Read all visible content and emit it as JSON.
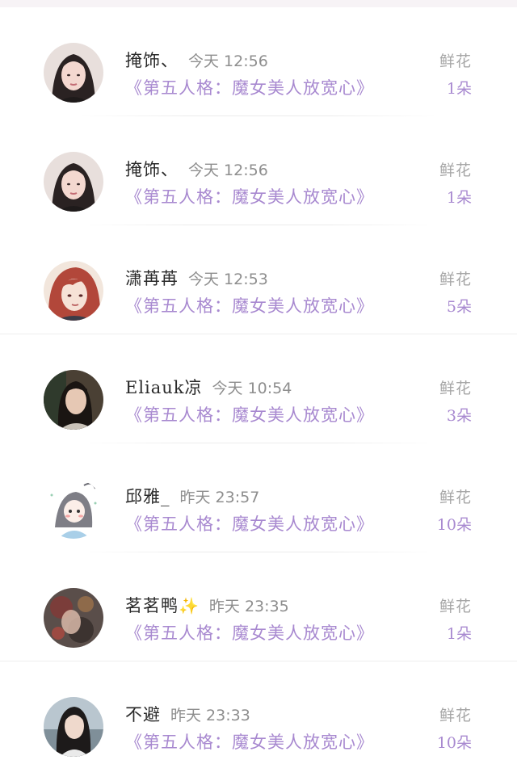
{
  "rows": [
    {
      "name": "掩饰、",
      "time": "今天 12:56",
      "book": "《第五人格：魔女美人放宽心》",
      "flower_label": "鲜花",
      "count": "1朵",
      "avatar": "avatar-girl-1"
    },
    {
      "name": "掩饰、",
      "time": "今天 12:56",
      "book": "《第五人格：魔女美人放宽心》",
      "flower_label": "鲜花",
      "count": "1朵",
      "avatar": "avatar-girl-1"
    },
    {
      "name": "潇苒苒",
      "time": "今天 12:53",
      "book": "《第五人格：魔女美人放宽心》",
      "flower_label": "鲜花",
      "count": "5朵",
      "avatar": "avatar-anime-redhair"
    },
    {
      "name": "Eliauk凉",
      "time": "今天 10:54",
      "book": "《第五人格：魔女美人放宽心》",
      "flower_label": "鲜花",
      "count": "3朵",
      "avatar": "avatar-girl-2"
    },
    {
      "name": "邱雅_",
      "time": "昨天 23:57",
      "book": "《第五人格：魔女美人放宽心》",
      "flower_label": "鲜花",
      "count": "10朵",
      "avatar": "avatar-cartoon"
    },
    {
      "name": "茗茗鸭",
      "sparkle": "✨",
      "time": "昨天 23:35",
      "book": "《第五人格：魔女美人放宽心》",
      "flower_label": "鲜花",
      "count": "1朵",
      "avatar": "avatar-flowers"
    },
    {
      "name": "不避",
      "time": "昨天 23:33",
      "book": "《第五人格：魔女美人放宽心》",
      "flower_label": "鲜花",
      "count": "10朵",
      "avatar": "avatar-girl-sea"
    }
  ],
  "colors": {
    "accent": "#a889d0",
    "muted": "#a6a6a6"
  }
}
